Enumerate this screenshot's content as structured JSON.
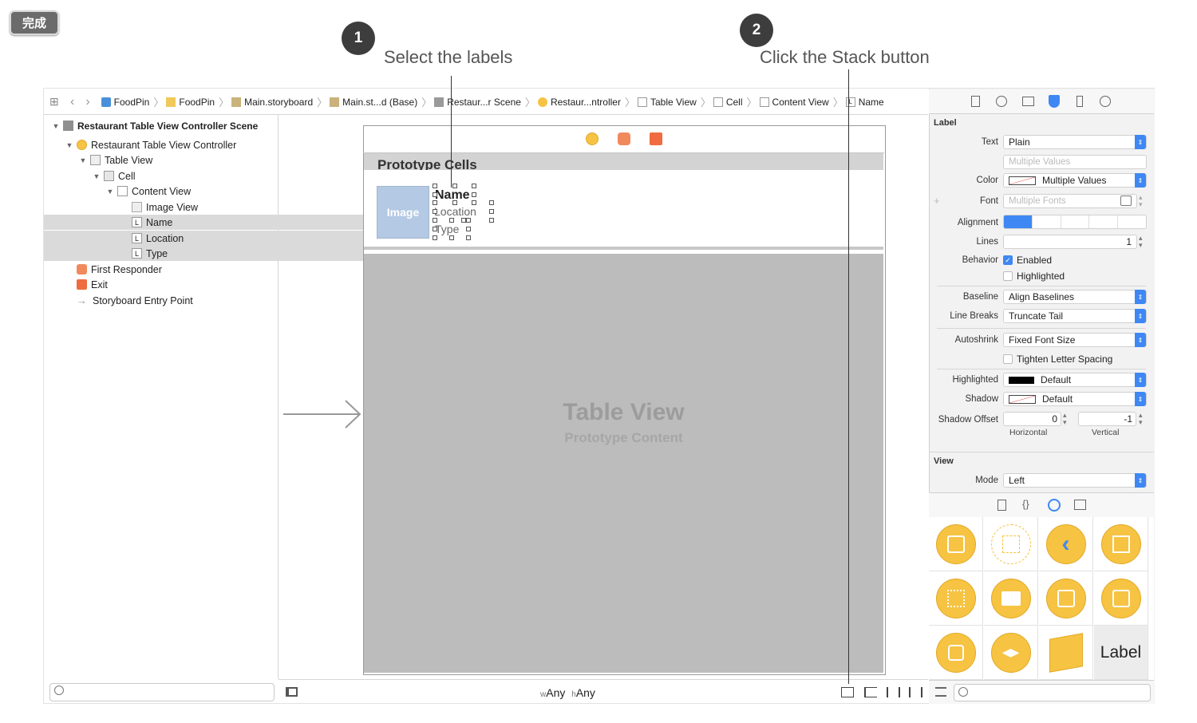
{
  "overlay": {
    "done_label": "完成",
    "steps": [
      {
        "number": "1",
        "text": "Select the labels"
      },
      {
        "number": "2",
        "text": "Click the Stack button"
      }
    ]
  },
  "jumpbar": [
    "FoodPin",
    "FoodPin",
    "Main.storyboard",
    "Main.st...d (Base)",
    "Restaur...r Scene",
    "Restaur...ntroller",
    "Table View",
    "Cell",
    "Content View",
    "Name"
  ],
  "outline": {
    "scene": "Restaurant Table View Controller Scene",
    "controller": "Restaurant Table View Controller",
    "table_view": "Table View",
    "cell": "Cell",
    "content_view": "Content View",
    "image_view": "Image View",
    "name": "Name",
    "location": "Location",
    "type": "Type",
    "first_responder": "First Responder",
    "exit": "Exit",
    "entry_point": "Storyboard Entry Point",
    "label_glyph": "L"
  },
  "canvas": {
    "prototype_cells": "Prototype Cells",
    "image_placeholder": "Image",
    "cell_labels": [
      "Name",
      "Location",
      "Type"
    ],
    "table_view_title": "Table View",
    "table_view_sub": "Prototype Content",
    "size_w_prefix": "w",
    "size_w": "Any",
    "size_h_prefix": "h",
    "size_h": "Any"
  },
  "inspector": {
    "label_section": "Label",
    "text_label": "Text",
    "text_value": "Plain",
    "text_placeholder": "Multiple Values",
    "color_label": "Color",
    "color_value": "Multiple Values",
    "font_label": "Font",
    "font_value": "Multiple Fonts",
    "alignment_label": "Alignment",
    "lines_label": "Lines",
    "lines_value": "1",
    "behavior_label": "Behavior",
    "enabled_label": "Enabled",
    "highlighted_check_label": "Highlighted",
    "baseline_label": "Baseline",
    "baseline_value": "Align Baselines",
    "line_breaks_label": "Line Breaks",
    "line_breaks_value": "Truncate Tail",
    "autoshrink_label": "Autoshrink",
    "autoshrink_value": "Fixed Font Size",
    "tighten_label": "Tighten Letter Spacing",
    "highlighted_label": "Highlighted",
    "highlighted_value": "Default",
    "shadow_label": "Shadow",
    "shadow_value": "Default",
    "shadow_offset_label": "Shadow Offset",
    "shadow_h_value": "0",
    "shadow_v_value": "-1",
    "horizontal_label": "Horizontal",
    "vertical_label": "Vertical",
    "view_section": "View",
    "mode_label": "Mode",
    "mode_value": "Left",
    "library_label_item": "Label"
  },
  "colors": {
    "accent": "#3f88f4",
    "library_yellow": "#f6c343",
    "image_view": "#b4c9e3",
    "table_view_bg": "#bcbcbc"
  }
}
